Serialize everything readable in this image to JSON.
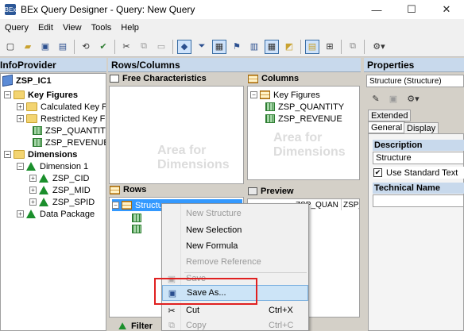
{
  "window": {
    "title": "BEx Query Designer - Query: New Query",
    "app_icon": "BEx",
    "controls": [
      "—",
      "☐",
      "✕"
    ]
  },
  "menu": [
    "Query",
    "Edit",
    "View",
    "Tools",
    "Help"
  ],
  "toolbar_icons": [
    "new-icon",
    "open-icon",
    "save-icon",
    "save-all-icon",
    "refresh-icon",
    "check-icon",
    "cut-icon",
    "copy-icon",
    "paste-icon",
    "cube-icon",
    "filter-icon",
    "rows-columns-icon",
    "flag-icon",
    "exceptions-icon",
    "table-view-icon",
    "conditions-icon",
    "cells-icon",
    "properties-icon",
    "messages-icon",
    "tools-icon"
  ],
  "infoprovider": {
    "header": "InfoProvider",
    "root": "ZSP_IC1",
    "tree": {
      "key_figures": "Key Figures",
      "calculated": "Calculated Key F",
      "restricted": "Restricted Key F",
      "kf1": "ZSP_QUANTITY",
      "kf2": "ZSP_REVENUE",
      "dimensions": "Dimensions",
      "dimension1": "Dimension 1",
      "d1": "ZSP_CID",
      "d2": "ZSP_MID",
      "d3": "ZSP_SPID",
      "data_package": "Data Package"
    }
  },
  "rows_columns": {
    "header": "Rows/Columns",
    "free_characteristics": "Free Characteristics",
    "columns": "Columns",
    "rows": "Rows",
    "preview": "Preview",
    "filter_tab": "Filter",
    "area_placeholder": "Area for Dimensions",
    "columns_tree": {
      "key_figures": "Key Figures",
      "kf1": "ZSP_QUANTITY",
      "kf2": "ZSP_REVENUE"
    },
    "rows_tree": {
      "structure": "Structure"
    },
    "preview_cells": [
      "ZSP_QUAN",
      "ZSP_"
    ]
  },
  "context_menu": {
    "items": [
      {
        "label": "New Structure",
        "disabled": true,
        "shortcut": ""
      },
      {
        "label": "New Selection",
        "disabled": false,
        "shortcut": ""
      },
      {
        "label": "New Formula",
        "disabled": false,
        "shortcut": ""
      },
      {
        "label": "Remove Reference",
        "disabled": true,
        "shortcut": ""
      },
      {
        "label": "Save",
        "disabled": true,
        "shortcut": ""
      },
      {
        "label": "Save As...",
        "disabled": false,
        "shortcut": ""
      },
      {
        "label": "Cut",
        "disabled": false,
        "shortcut": "Ctrl+X"
      },
      {
        "label": "Copy",
        "disabled": true,
        "shortcut": "Ctrl+C"
      }
    ]
  },
  "properties": {
    "header": "Properties",
    "selector": "Structure (Structure)",
    "tabs": [
      "Extended",
      "General",
      "Display"
    ],
    "description_label": "Description",
    "description_value": "Structure",
    "use_standard_text": "Use Standard Text",
    "use_standard_text_checked": true,
    "technical_name_label": "Technical Name",
    "technical_name_value": ""
  },
  "colors": {
    "header_bg": "#c8d9ec",
    "highlight_border": "#e02020",
    "menu_hover": "#cce4f7"
  }
}
